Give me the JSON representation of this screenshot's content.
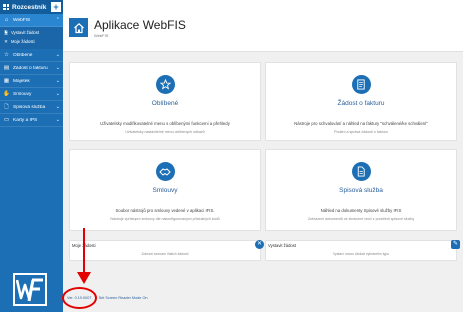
{
  "sidebar": {
    "title": "Rozcestník",
    "plus": "+",
    "items": [
      {
        "label": "WebFIS",
        "active": true
      },
      {
        "label": "Oblíbené"
      },
      {
        "label": "Žádost o fakturu"
      },
      {
        "label": "Majetek"
      },
      {
        "label": "Smlouvy"
      },
      {
        "label": "Spisová služba"
      },
      {
        "label": "Karty a IPS"
      }
    ],
    "sub_items": [
      {
        "label": "Vystavit žádost"
      },
      {
        "label": "Moje žádosti"
      }
    ]
  },
  "header": {
    "title": "Aplikace WebFIS",
    "subtitle": "WebFIS"
  },
  "cards": [
    {
      "title": "Oblíbené",
      "desc": "Uživatelsky modifikovatelné menu s oblíbenými funkcemi a přehledy",
      "sub": "Uživatelsky nastavitelné menu oblíbených odkazů"
    },
    {
      "title": "Žádost o fakturu",
      "desc": "Nástroje pro schvalování a náhled na faktury \"schválené/ke schválení\"",
      "sub": "Podání a správa žádostí o fakturu"
    },
    {
      "title": "Smlouvy",
      "desc": "Soubor nástrojů pro smlouvy vedené v aplikaci IFIS.",
      "sub": "Nástroje zpřístupní smlouvy dle nakonfigurovaných příslušných kódů"
    },
    {
      "title": "Spisová služba",
      "desc": "Náhled na dokumenty Spisové služby IFIS",
      "sub": "Zobrazení dokumentů ve zkrácené verzi z prostředí spisové služby"
    }
  ],
  "small_cards": [
    {
      "title": "Moje žádosti",
      "desc": "Zobrazí seznam Vašich žádostí"
    },
    {
      "title": "Vystavit žádost",
      "desc": "Vystaví novou žádost vybraného typu"
    }
  ],
  "footer": {
    "version": "Ver. 0.19.0007",
    "screen_reader": "Set Screen Reader Mode On"
  },
  "colors": {
    "brand": "#1c6fb5",
    "annotation": "#e30000"
  }
}
